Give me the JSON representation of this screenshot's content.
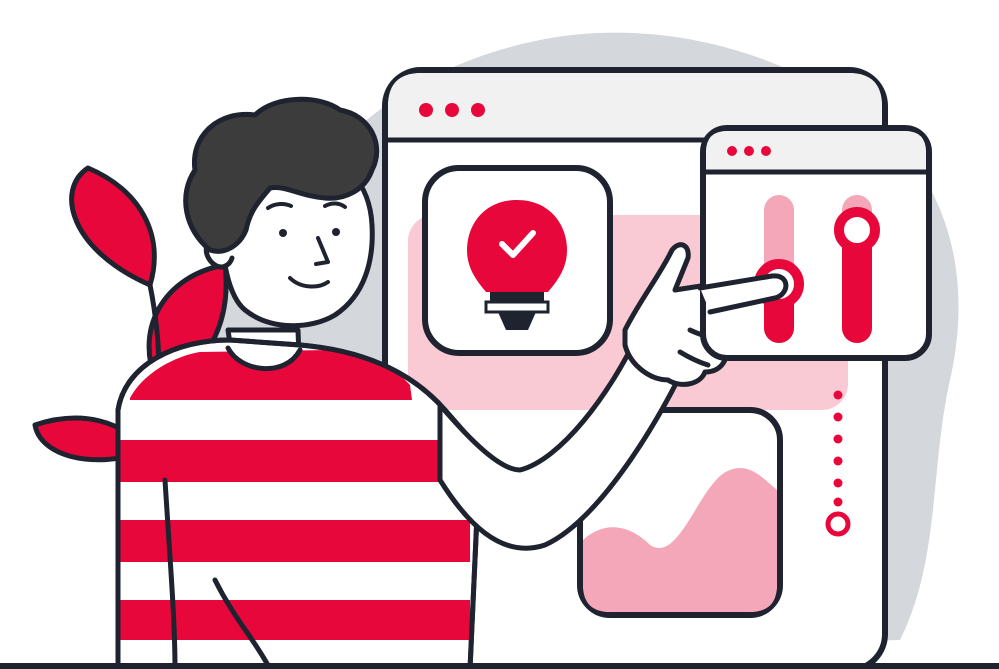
{
  "illustration": {
    "colors": {
      "accent": "#E8073A",
      "accent_light": "#F4A7B9",
      "accent_pale": "#F9C9D4",
      "outline": "#1F2330",
      "backdrop": "#D4D7DC",
      "window_bar": "#F1F1F1",
      "skin": "#FFFFFF",
      "hair": "#3C3C3C"
    },
    "icons": {
      "bulb": "lightbulb-check-icon",
      "check": "check-icon",
      "sliders": "sliders-icon",
      "dots": "window-dots-icon"
    },
    "slider_levels": {
      "left": 0.4,
      "right": 0.8
    }
  }
}
